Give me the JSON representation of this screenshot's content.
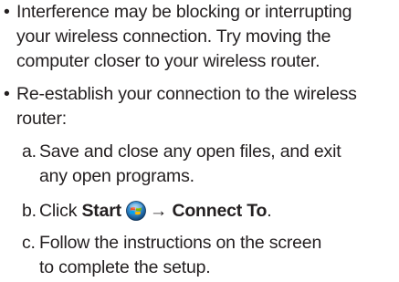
{
  "bullet_glyph": "•",
  "items": [
    {
      "lines": [
        "Interference may be blocking or interrupting",
        "your wireless connection. Try moving the",
        "computer closer to your wireless router."
      ]
    },
    {
      "lines": [
        "Re-establish your connection to the wireless",
        "router:"
      ],
      "steps": [
        {
          "letter": "a.",
          "lines": [
            "Save and close any open files, and exit",
            "any open programs."
          ]
        },
        {
          "letter": "b.",
          "text_before": "Click",
          "bold_start": "Start",
          "start_icon": "windows-start-orb-icon",
          "arrow": "→",
          "bold_connect": "Connect To",
          "period": "."
        },
        {
          "letter": "c.",
          "lines": [
            "Follow the instructions on the screen",
            "to complete the setup."
          ]
        }
      ]
    }
  ]
}
